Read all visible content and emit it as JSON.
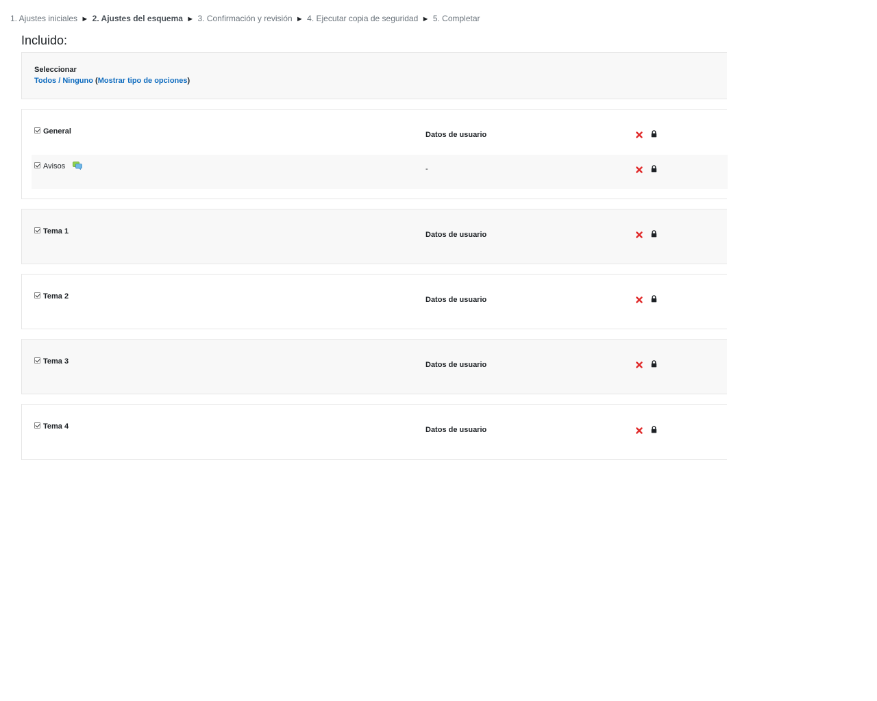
{
  "progress": {
    "steps": [
      "1. Ajustes iniciales",
      "2. Ajustes del esquema",
      "3. Confirmación y revisión",
      "4. Ejecutar copia de seguridad",
      "5. Completar"
    ],
    "separator": "►",
    "current_step_index": 1
  },
  "included_title": "Incluido:",
  "select": {
    "label": "Seleccionar",
    "all": "Todos",
    "slash": " / ",
    "none": "Ninguno",
    "open_paren": " (",
    "show_types": "Mostrar tipo de opciones",
    "close_paren": ")"
  },
  "sections": [
    {
      "name": "General",
      "userdata": "Datos de usuario",
      "activities": [
        {
          "name": "Avisos",
          "userdata": "-",
          "icon": "forum-icon"
        }
      ]
    },
    {
      "name": "Tema 1",
      "userdata": "Datos de usuario",
      "activities": []
    },
    {
      "name": "Tema 2",
      "userdata": "Datos de usuario",
      "activities": []
    },
    {
      "name": "Tema 3",
      "userdata": "Datos de usuario",
      "activities": []
    },
    {
      "name": "Tema 4",
      "userdata": "Datos de usuario",
      "activities": []
    }
  ],
  "colors": {
    "link": "#0f6cbf",
    "cross": "#e02b2b",
    "panel_alt": "#f8f8f8",
    "border": "#e6e6e6"
  },
  "icons": {
    "cross": "cross-icon",
    "lock": "lock-icon",
    "checkbox": "checkbox-checked"
  }
}
